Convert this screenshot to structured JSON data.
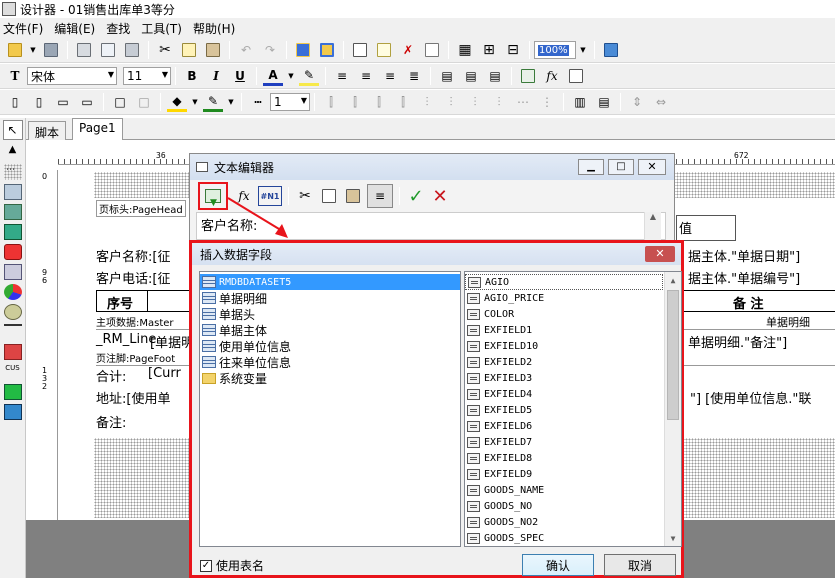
{
  "app": {
    "title": "设计器 - 01销售出库单3等分"
  },
  "menu": [
    "文件(F)",
    "编辑(E)",
    "查找",
    "工具(T)",
    "帮助(H)"
  ],
  "toolbar2": {
    "font": "宋体",
    "size": "11"
  },
  "toolbar1": {
    "zoom": "100%"
  },
  "toolbar3": {
    "linewidth": "1"
  },
  "tabs": [
    "脚本",
    "Page1"
  ],
  "ruler": {
    "h": [
      "36",
      "672"
    ],
    "v": [
      "0",
      "9",
      "6",
      "1",
      "3",
      "2"
    ]
  },
  "report": {
    "page_header_band": "页标头:PageHead",
    "customer_name": "客户名称:[征",
    "customer_phone": "客户电话:[征",
    "right_date": "据主体.\"单据日期\"]",
    "right_no": "据主体.\"单据编号\"]",
    "col_seq": "序号",
    "col_remark": "备    注",
    "master_band": "主项数据:Master",
    "master_right": "单据明细",
    "rm_line": "_RM_Line",
    "rm_line_val": "[单据明",
    "detail_remark": "单据明细.\"备注\"]",
    "page_footer_band": "页注脚:PageFoot",
    "total": "合计:",
    "total_val": "[Curr",
    "address": "地址:[使用单",
    "address_right": "\"] [使用单位信息.\"联",
    "remark": "备注:"
  },
  "text_editor": {
    "title": "文本编辑器",
    "content_line": "客户名称:",
    "right_frag": "值"
  },
  "insert_dialog": {
    "title": "插入数据字段",
    "tables": [
      "RMDBDATASET5",
      "单据明细",
      "单据头",
      "单据主体",
      "使用单位信息",
      "往来单位信息"
    ],
    "folder": "系统变量",
    "fields": [
      "AGIO",
      "AGIO_PRICE",
      "COLOR",
      "EXFIELD1",
      "EXFIELD10",
      "EXFIELD2",
      "EXFIELD3",
      "EXFIELD4",
      "EXFIELD5",
      "EXFIELD6",
      "EXFIELD7",
      "EXFIELD8",
      "EXFIELD9",
      "GOODS_NAME",
      "GOODS_NO",
      "GOODS_NO2",
      "GOODS_SPEC"
    ],
    "use_table_name_label": "使用表名",
    "use_table_name_checked": true,
    "ok_label": "确认",
    "cancel_label": "取消"
  },
  "colors": {
    "highlight_red": "#e8141b",
    "selection": "#3399ff",
    "dialog_title_grad": "#dce6f4"
  }
}
